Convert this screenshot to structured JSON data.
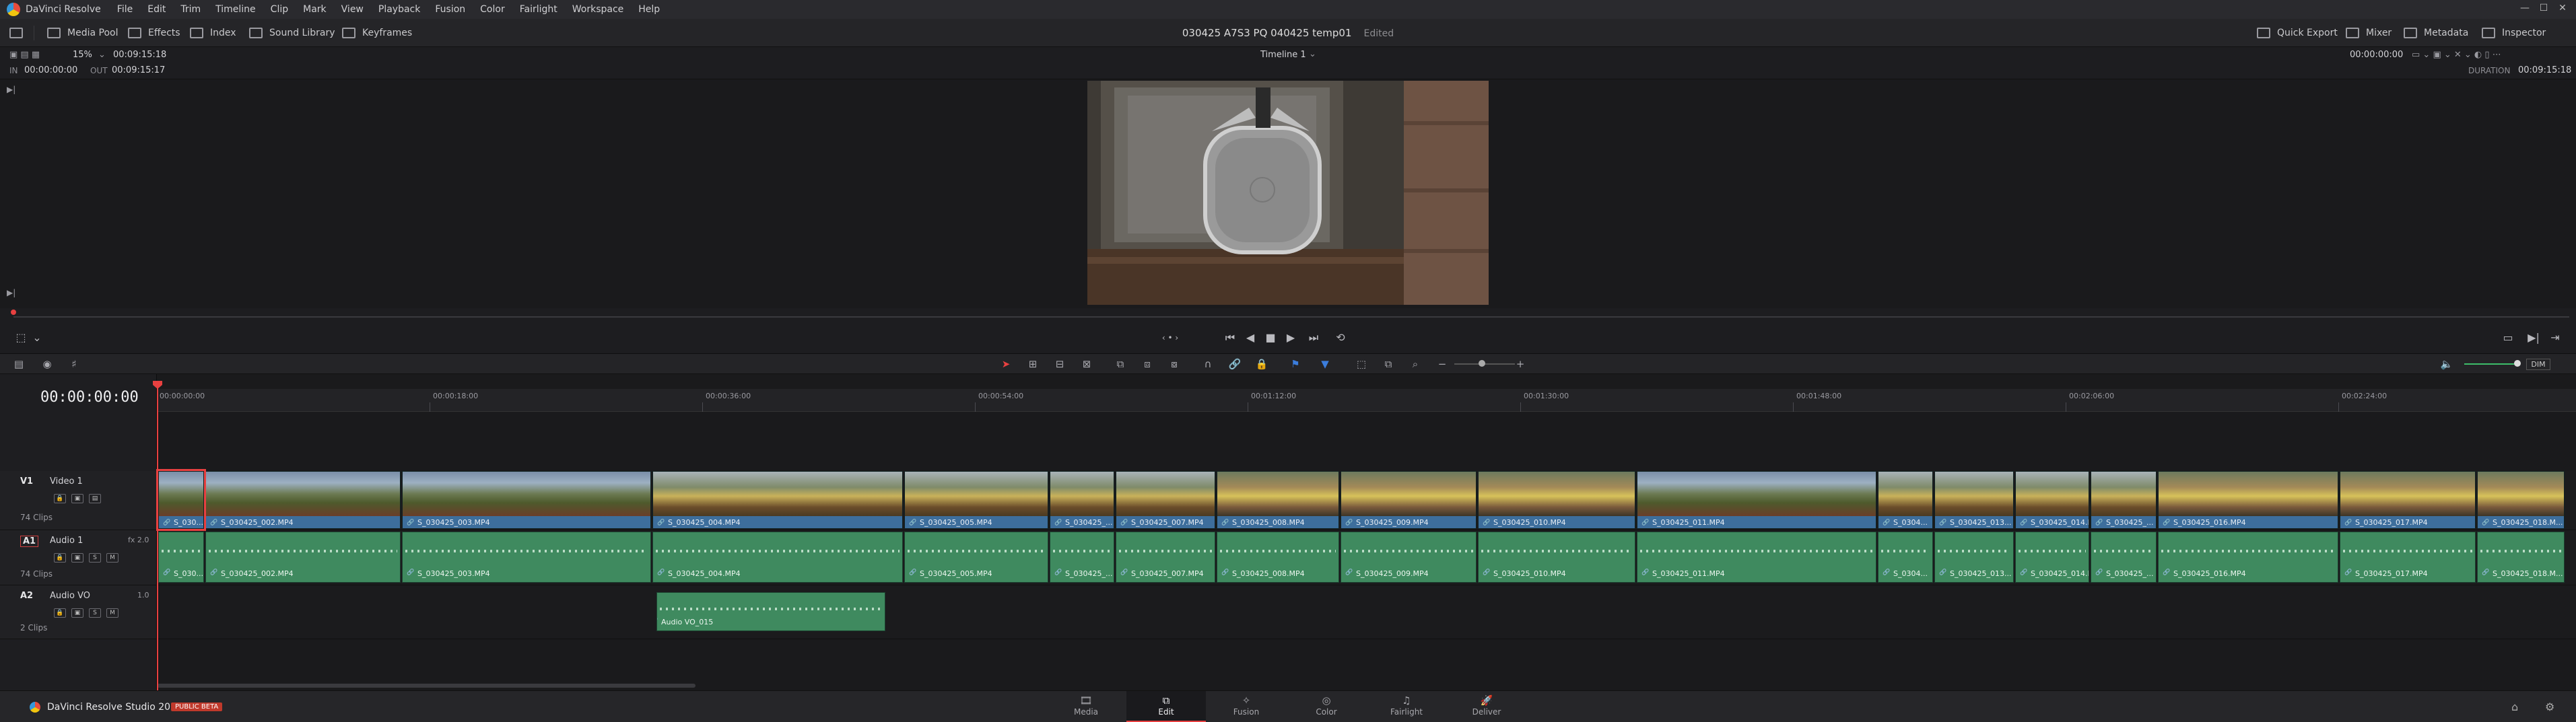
{
  "menubar": {
    "app": "DaVinci Resolve",
    "items": [
      "File",
      "Edit",
      "Trim",
      "Timeline",
      "Clip",
      "Mark",
      "View",
      "Playback",
      "Fusion",
      "Color",
      "Fairlight",
      "Workspace",
      "Help"
    ]
  },
  "toolbar": {
    "left": [
      "Media Pool",
      "Effects",
      "Index",
      "Sound Library",
      "Keyframes"
    ],
    "project": "030425 A7S3 PQ 040425 temp01",
    "status": "Edited",
    "right": [
      "Quick Export",
      "Mixer",
      "Metadata",
      "Inspector"
    ]
  },
  "viewer": {
    "zoom": "15%",
    "clip_duration": "00:09:15:18",
    "timeline_name": "Timeline 1",
    "in_label": "IN",
    "in_tc": "00:00:00:00",
    "out_label": "OUT",
    "out_tc": "00:09:15:17",
    "current_tc": "00:00:00:00",
    "duration_label": "DURATION",
    "duration_tc": "00:09:15:18",
    "volume_label": "DIM"
  },
  "timeline": {
    "timecode": "00:00:00:00",
    "ruler": [
      "00:00:00:00",
      "00:00:18:00",
      "00:00:36:00",
      "00:00:54:00",
      "00:01:12:00",
      "00:01:30:00",
      "00:01:48:00",
      "00:02:06:00",
      "00:02:24:00"
    ],
    "tracks": {
      "v1": {
        "id": "V1",
        "name": "Video 1",
        "clips": "74 Clips"
      },
      "a1": {
        "id": "A1",
        "name": "Audio 1",
        "fx": "fx  2.0",
        "clips": "74 Clips"
      },
      "a2": {
        "id": "A2",
        "name": "Audio VO",
        "level": "1.0",
        "clips": "2 Clips"
      }
    },
    "video_clips": [
      "S_030...",
      "S_030425_002.MP4",
      "S_030425_003.MP4",
      "S_030425_004.MP4",
      "S_030425_005.MP4",
      "S_030425_...",
      "S_030425_007.MP4",
      "S_030425_008.MP4",
      "S_030425_009.MP4",
      "S_030425_010.MP4",
      "S_030425_011.MP4",
      "S_0304...",
      "S_030425_013...",
      "S_030425_014.M...",
      "S_030425_...",
      "S_030425_016.MP4",
      "S_030425_017.MP4",
      "S_030425_018.M..."
    ],
    "audio_clips": [
      "S_030...",
      "S_030425_002.MP4",
      "S_030425_003.MP4",
      "S_030425_004.MP4",
      "S_030425_005.MP4",
      "S_030425_...",
      "S_030425_007.MP4",
      "S_030425_008.MP4",
      "S_030425_009.MP4",
      "S_030425_010.MP4",
      "S_030425_011.MP4",
      "S_0304...",
      "S_030425_013...",
      "S_030425_014.M...",
      "S_030425_...",
      "S_030425_016.MP4",
      "S_030425_017.MP4",
      "S_030425_018.M..."
    ],
    "vo_clip": "Audio VO_015"
  },
  "pagebar": {
    "product": "DaVinci Resolve Studio 20",
    "badge": "PUBLIC BETA",
    "pages": [
      "Media",
      "Edit",
      "Fusion",
      "Color",
      "Fairlight",
      "Deliver"
    ]
  },
  "colors": {
    "accent": "#e84040",
    "video_clip": "#3d6e9c",
    "audio_clip": "#3f8a5f"
  }
}
